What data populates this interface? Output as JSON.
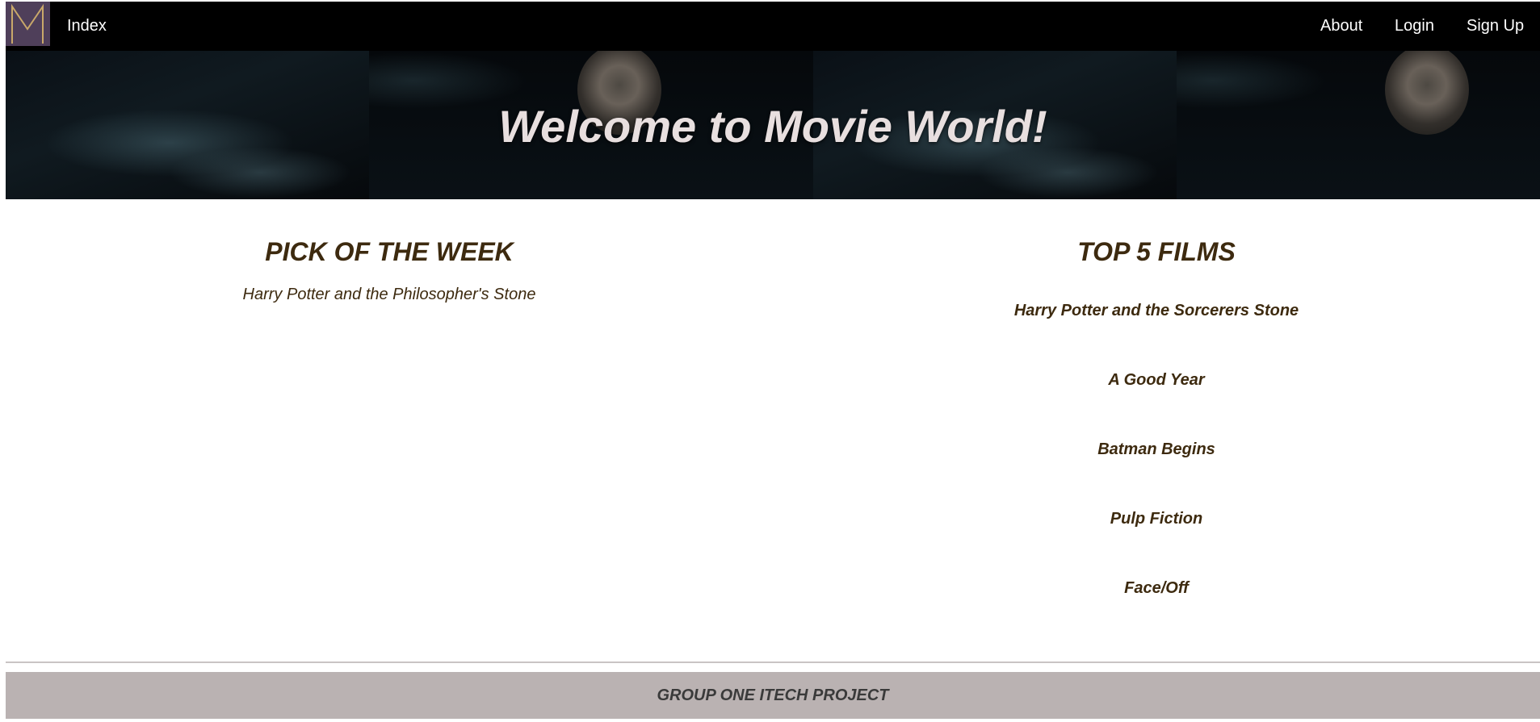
{
  "nav": {
    "logo_letter": "M",
    "index_label": "Index",
    "links": {
      "about": "About",
      "login": "Login",
      "signup": "Sign Up"
    }
  },
  "hero": {
    "title": "Welcome to Movie World!"
  },
  "pick_of_week": {
    "heading": "PICK OF THE WEEK",
    "film": "Harry Potter and the Philosopher's Stone"
  },
  "top_films": {
    "heading": "TOP 5 FILMS",
    "items": [
      "Harry Potter and the Sorcerers Stone",
      "A Good Year",
      "Batman Begins",
      "Pulp Fiction",
      "Face/Off"
    ]
  },
  "footer": {
    "text": "GROUP ONE ITECH PROJECT"
  },
  "colors": {
    "nav_bg": "#000000",
    "logo_bg": "#4f3f5a",
    "logo_stroke": "#c9a86a",
    "heading_text": "#3d2a0f",
    "footer_bg": "#bab2b2"
  }
}
